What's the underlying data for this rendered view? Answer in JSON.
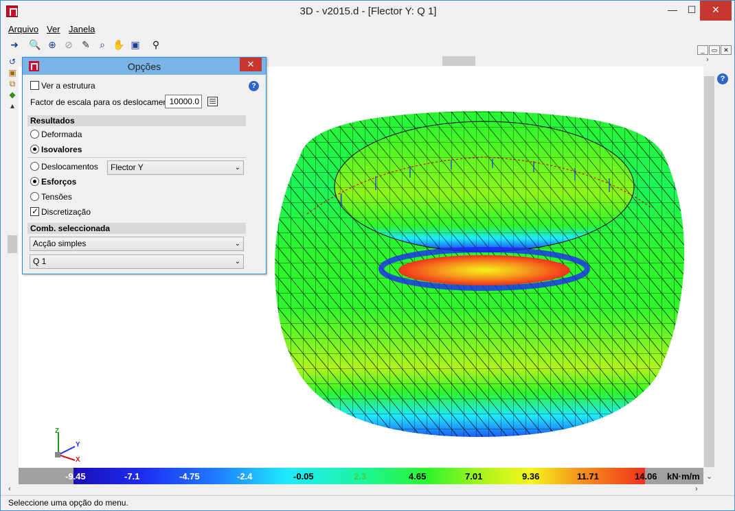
{
  "window": {
    "title": "3D - v2015.d - [Flector Y: Q 1]",
    "min": "—",
    "max": "☐",
    "close": "✕"
  },
  "menu": {
    "items": [
      "Arquivo",
      "Ver",
      "Janela"
    ]
  },
  "toolbar": {
    "icons": [
      "exit-icon",
      "zoom-pointer-icon",
      "zoom-window-icon",
      "zoom-all-icon",
      "pen-icon",
      "zoom-search-icon",
      "pan-hand-icon",
      "print-preview-icon",
      "binoculars-icon"
    ]
  },
  "options_panel": {
    "title": "Opções",
    "close": "✕",
    "help": "?",
    "show_structure": {
      "label": "Ver a estrutura",
      "checked": false
    },
    "scale_factor": {
      "label": "Factor de escala para os deslocamentos",
      "value": "10000.0"
    },
    "results": {
      "section": "Resultados",
      "deformada": "Deformada",
      "isovalores": "Isovalores",
      "deslocamentos": "Deslocamentos",
      "esforcos": "Esforços",
      "tensoes": "Tensões",
      "discretizacao": "Discretização",
      "component": "Flector Y"
    },
    "combination": {
      "section": "Comb. seleccionada",
      "type": "Acção simples",
      "case": "Q 1"
    }
  },
  "legend": {
    "labels": [
      "-9.45",
      "-7.1",
      "-4.75",
      "-2.4",
      "-0.05",
      "2.3",
      "4.65",
      "7.01",
      "9.36",
      "11.71",
      "14.06"
    ],
    "unit": "kN·m/m",
    "colors": [
      "#1a0fb4",
      "#1fe8ff",
      "#2ef52c",
      "#f5f51c",
      "#f2301c"
    ]
  },
  "axes": {
    "z": "Z",
    "y": "Y",
    "x": "X"
  },
  "status": {
    "text": "Seleccione uma opção do menu."
  }
}
